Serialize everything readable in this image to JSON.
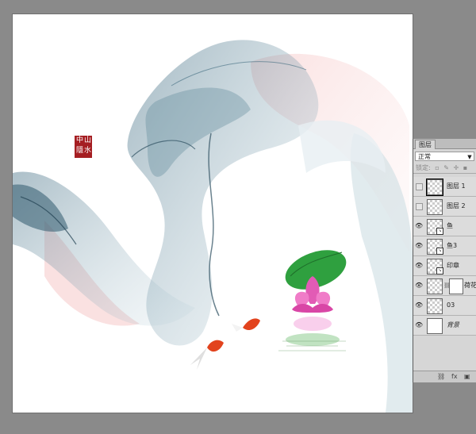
{
  "artwork": {
    "seal_chars": [
      "山",
      "中",
      "水",
      "隱"
    ]
  },
  "layers_panel": {
    "tab_label": "图层",
    "blend_mode": "正常",
    "lock_label": "锁定:",
    "layers": [
      {
        "name": "图层 1",
        "visible": false,
        "thumb": "checker",
        "selected": true
      },
      {
        "name": "图层 2",
        "visible": false,
        "thumb": "checker"
      },
      {
        "name": "鱼",
        "visible": true,
        "thumb": "checker",
        "linked": true
      },
      {
        "name": "鱼3",
        "visible": true,
        "thumb": "checker",
        "linked": true
      },
      {
        "name": "印章",
        "visible": true,
        "thumb": "checker",
        "linked": true
      },
      {
        "name": "荷花",
        "visible": true,
        "thumb": "checker",
        "mask": true
      },
      {
        "name": "03",
        "visible": true,
        "thumb": "checker"
      },
      {
        "name": "背景",
        "visible": true,
        "thumb": "white",
        "italic": true
      }
    ],
    "footer_icons": [
      "link-icon",
      "fx-icon",
      "new-layer-icon"
    ],
    "footer_fx": "fx"
  }
}
